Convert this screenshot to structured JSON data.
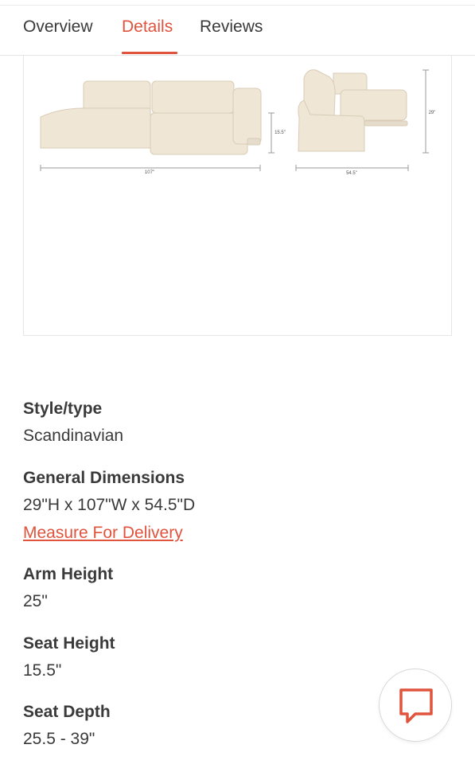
{
  "tabs": [
    {
      "label": "Overview",
      "active": false
    },
    {
      "label": "Details",
      "active": true
    },
    {
      "label": "Reviews",
      "active": false
    }
  ],
  "image": {
    "dim_width": "107\"",
    "dim_height_seat": "15.5\"",
    "dim_depth": "54.5\"",
    "dim_height_total": "29\""
  },
  "specs": {
    "style": {
      "label": "Style/type",
      "value": "Scandinavian"
    },
    "general": {
      "label": "General Dimensions",
      "value": "29\"H x 107\"W x 54.5\"D",
      "link": "Measure For Delivery"
    },
    "arm": {
      "label": "Arm Height",
      "value": "25\""
    },
    "seat_height": {
      "label": "Seat Height",
      "value": "15.5\""
    },
    "seat_depth": {
      "label": "Seat Depth",
      "value": "25.5 - 39\""
    }
  },
  "chat": {
    "icon": "chat-bubble-icon"
  },
  "colors": {
    "accent": "#e0533d",
    "text": "#3a3a3a",
    "sofa": "#efe6d6"
  }
}
